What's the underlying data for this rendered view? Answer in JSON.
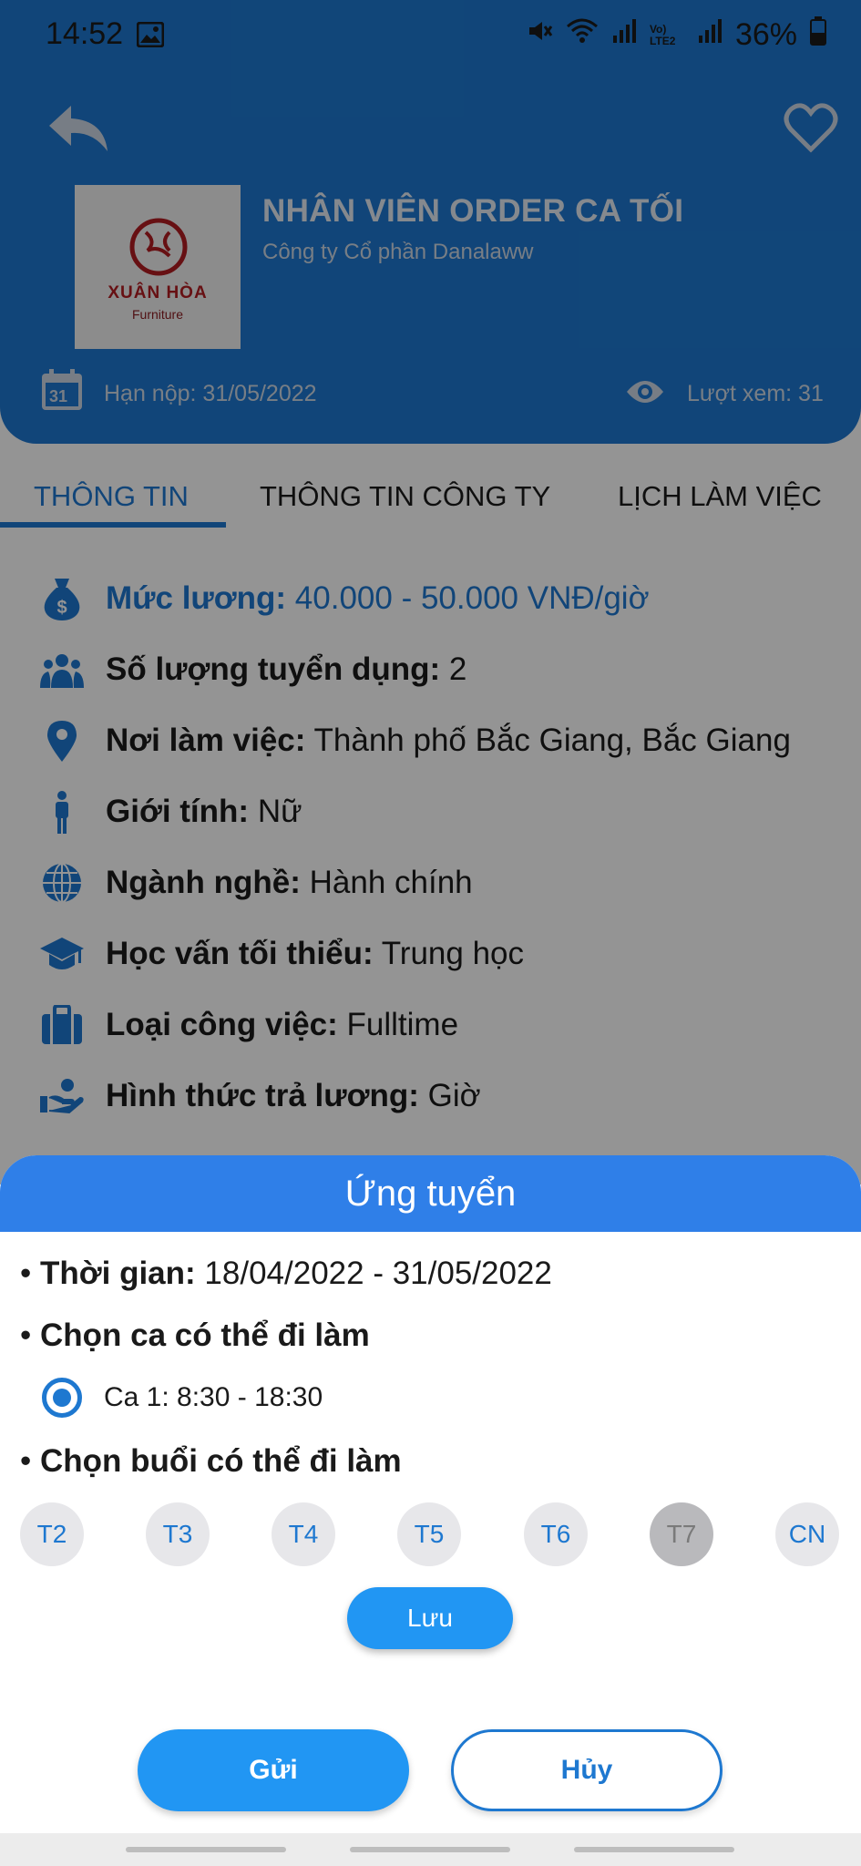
{
  "status": {
    "time": "14:52",
    "battery": "36%",
    "network": "Vo) LTE2"
  },
  "header": {
    "logo": {
      "brand": "XUÂN HÒA",
      "sub": "Furniture"
    },
    "job_title": "NHÂN VIÊN ORDER CA TỐI",
    "company": "Công ty Cổ phần Danalaww",
    "deadline": "Hạn nộp: 31/05/2022",
    "calendar_day": "31",
    "views": "Lượt xem: 31"
  },
  "tabs": [
    "THÔNG TIN",
    "THÔNG TIN CÔNG TY",
    "LỊCH LÀM VIỆC"
  ],
  "info": [
    {
      "label": "Mức lương:",
      "value": "40.000 - 50.000 VNĐ/giờ",
      "icon": "money-bag-icon"
    },
    {
      "label": "Số lượng tuyển dụng:",
      "value": "2",
      "icon": "people-icon"
    },
    {
      "label": "Nơi làm việc:",
      "value": "Thành phố Bắc Giang, Bắc Giang",
      "icon": "location-pin-icon"
    },
    {
      "label": "Giới tính:",
      "value": "Nữ",
      "icon": "person-icon"
    },
    {
      "label": "Ngành nghề:",
      "value": "Hành chính",
      "icon": "globe-icon"
    },
    {
      "label": "Học vấn tối thiểu:",
      "value": "Trung học",
      "icon": "graduation-cap-icon"
    },
    {
      "label": "Loại công việc:",
      "value": "Fulltime",
      "icon": "briefcase-icon"
    },
    {
      "label": "Hình thức trả lương:",
      "value": "Giờ",
      "icon": "hand-money-icon"
    }
  ],
  "sheet": {
    "title": "Ứng tuyển",
    "time_label": "Thời gian:",
    "time_value": "18/04/2022 - 31/05/2022",
    "shift_heading": "Chọn ca có thể đi làm",
    "shift_option": "Ca 1: 8:30 - 18:30",
    "day_heading": "Chọn buổi có thể đi làm",
    "days": [
      "T2",
      "T3",
      "T4",
      "T5",
      "T6",
      "T7",
      "CN"
    ],
    "selected_day": "T7",
    "save": "Lưu",
    "send": "Gửi",
    "cancel": "Hủy"
  },
  "colors": {
    "primary": "#1e78d0",
    "sheet_header": "#2f7fe8",
    "button": "#2196f3"
  }
}
